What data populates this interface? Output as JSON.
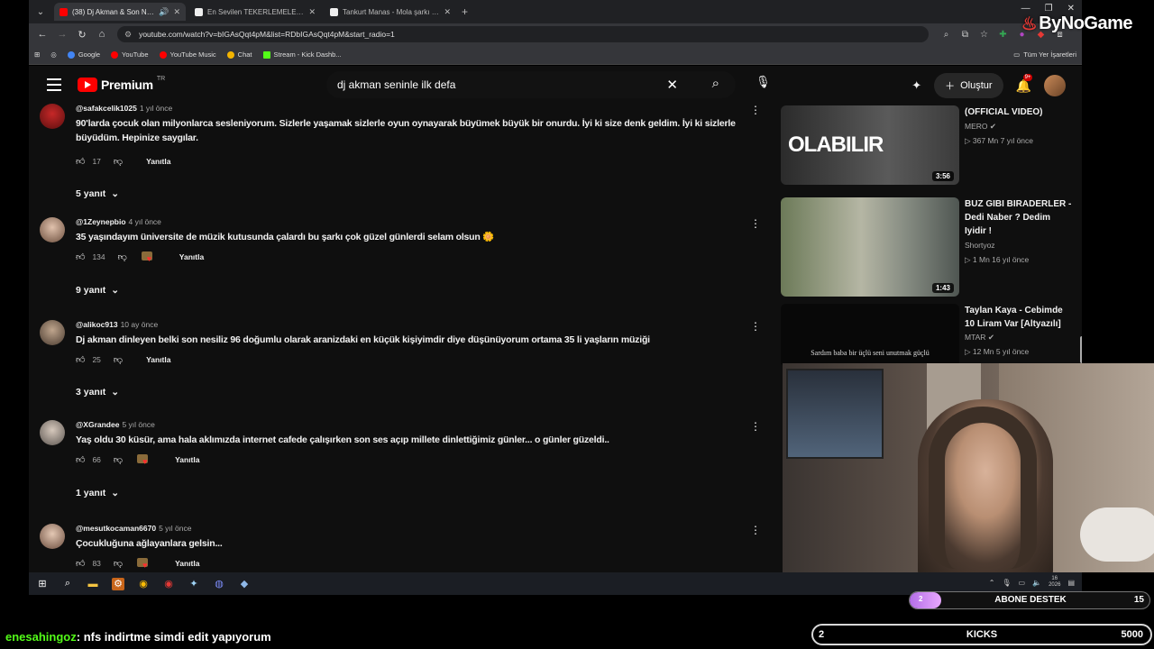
{
  "browser": {
    "tabs": [
      {
        "title": "(38) Dj Akman & Son Nefes",
        "active": true,
        "favicon_color": "#ff0000"
      },
      {
        "title": "En Sevilen TEKERLEMELER (Ses",
        "active": false,
        "favicon_color": "#ffffff"
      },
      {
        "title": "Tankurt Manas - Mola şarkı söz",
        "active": false,
        "favicon_color": "#ffffff"
      }
    ],
    "new_tab": "+",
    "url": "youtube.com/watch?v=bIGAsQqt4pM&list=RDbIGAsQqt4pM&start_radio=1",
    "bookmarks": [
      {
        "label": "Google",
        "color": "#4285f4"
      },
      {
        "label": "YouTube",
        "color": "#ff0000"
      },
      {
        "label": "YouTube Music",
        "color": "#ff0000"
      },
      {
        "label": "Chat",
        "color": "#f4b400"
      },
      {
        "label": "Stream - Kick Dashb...",
        "color": "#53fc18"
      }
    ],
    "all_bookmarks": "Tüm Yer İşaretleri"
  },
  "overlay_logo": "ByNoGame",
  "youtube": {
    "logo_text": "Premium",
    "logo_region": "TR",
    "search_value": "dj akman seninle ilk defa",
    "create_label": "Oluştur",
    "notification_badge": "9+",
    "comments": [
      {
        "handle": "@safakcelik1025",
        "time": "1 yıl önce",
        "text": "90'larda çocuk olan milyonlarca sesleniyorum. Sizlerle yaşamak sizlerle oyun oynayarak büyümek büyük bir onurdu. İyi ki size denk geldim. İyi ki sizlerle büyüdüm. Hepinize saygılar.",
        "likes": "17",
        "reply_label": "Yanıtla",
        "replies": "5 yanıt"
      },
      {
        "handle": "@1Zeynepbio",
        "time": "4 yıl önce",
        "text": "35 yaşındayım üniversite de müzik kutusunda çalardı bu şarkı çok güzel günlerdi selam olsun 🌼",
        "likes": "134",
        "reply_label": "Yanıtla",
        "replies": "9 yanıt"
      },
      {
        "handle": "@alikoc913",
        "time": "10 ay önce",
        "text": "Dj akman dinleyen belki son nesiliz 96 doğumlu olarak aranizdaki en küçük kişiyimdir diye düşünüyorum ortama 35 li yaşların müziği",
        "likes": "25",
        "reply_label": "Yanıtla",
        "replies": "3 yanıt"
      },
      {
        "handle": "@XGrandee",
        "time": "5 yıl önce",
        "text": "Yaş oldu 30 küsür, ama hala aklımızda internet cafede çalışırken son ses açıp millete dinlettiğimiz günler... o günler güzeldi..",
        "likes": "66",
        "reply_label": "Yanıtla",
        "replies": "1 yanıt"
      },
      {
        "handle": "@mesutkocaman6670",
        "time": "5 yıl önce",
        "text": "Çocukluğuna ağlayanlara gelsin...",
        "likes": "83",
        "reply_label": "Yanıtla",
        "replies": ""
      }
    ],
    "sidebar": [
      {
        "title": "(OFFICIAL VIDEO)",
        "channel": "MERO",
        "stats": "367 Mn  7 yıl önce",
        "duration": "3:56",
        "thumb_text": "OLABILIR"
      },
      {
        "title": "BUZ GIBI BIRADERLER - Dedi Naber ? Dedim Iyidir !",
        "channel": "Shortyoz",
        "stats": "1 Mn  16 yıl önce",
        "duration": "1:43",
        "thumb_text": ""
      },
      {
        "title": "Taylan Kaya - Cebimde 10 Liram Var [Altyazılı]",
        "channel": "MTAR",
        "stats": "12 Mn  5 yıl önce",
        "duration": "",
        "thumb_text": "Sardım baba bir üçlü seni unutmak güçlü"
      }
    ]
  },
  "taskbar": {
    "clock_day": "16",
    "clock_year": "2026"
  },
  "stream": {
    "abone": {
      "label": "ABONE DESTEK",
      "current": "2",
      "goal": "15",
      "progress": 0.13
    },
    "kicks": {
      "label": "KICKS",
      "current": "2",
      "goal": "5000"
    },
    "chat": {
      "user": "enesahingoz",
      "message": ": nfs indirtme simdi edit yapıyorum"
    }
  }
}
